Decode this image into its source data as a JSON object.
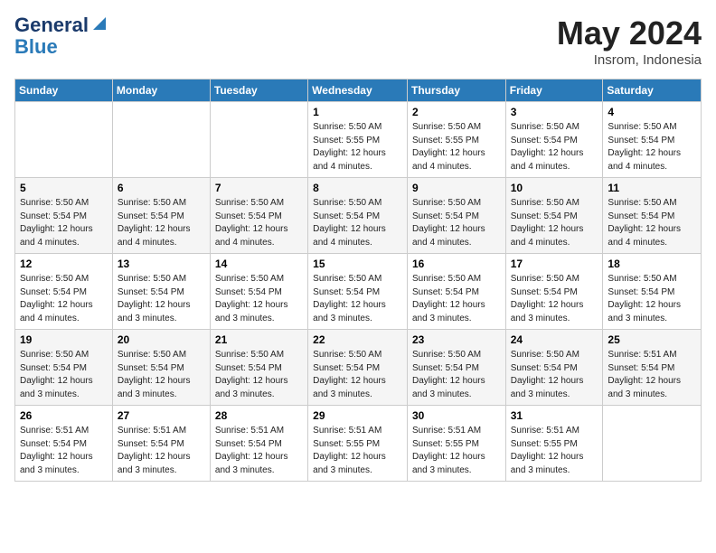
{
  "header": {
    "logo_line1": "General",
    "logo_line2": "Blue",
    "month_year": "May 2024",
    "location": "Insrom, Indonesia"
  },
  "weekdays": [
    "Sunday",
    "Monday",
    "Tuesday",
    "Wednesday",
    "Thursday",
    "Friday",
    "Saturday"
  ],
  "weeks": [
    [
      {
        "day": "",
        "info": ""
      },
      {
        "day": "",
        "info": ""
      },
      {
        "day": "",
        "info": ""
      },
      {
        "day": "1",
        "info": "Sunrise: 5:50 AM\nSunset: 5:55 PM\nDaylight: 12 hours\nand 4 minutes."
      },
      {
        "day": "2",
        "info": "Sunrise: 5:50 AM\nSunset: 5:55 PM\nDaylight: 12 hours\nand 4 minutes."
      },
      {
        "day": "3",
        "info": "Sunrise: 5:50 AM\nSunset: 5:54 PM\nDaylight: 12 hours\nand 4 minutes."
      },
      {
        "day": "4",
        "info": "Sunrise: 5:50 AM\nSunset: 5:54 PM\nDaylight: 12 hours\nand 4 minutes."
      }
    ],
    [
      {
        "day": "5",
        "info": "Sunrise: 5:50 AM\nSunset: 5:54 PM\nDaylight: 12 hours\nand 4 minutes."
      },
      {
        "day": "6",
        "info": "Sunrise: 5:50 AM\nSunset: 5:54 PM\nDaylight: 12 hours\nand 4 minutes."
      },
      {
        "day": "7",
        "info": "Sunrise: 5:50 AM\nSunset: 5:54 PM\nDaylight: 12 hours\nand 4 minutes."
      },
      {
        "day": "8",
        "info": "Sunrise: 5:50 AM\nSunset: 5:54 PM\nDaylight: 12 hours\nand 4 minutes."
      },
      {
        "day": "9",
        "info": "Sunrise: 5:50 AM\nSunset: 5:54 PM\nDaylight: 12 hours\nand 4 minutes."
      },
      {
        "day": "10",
        "info": "Sunrise: 5:50 AM\nSunset: 5:54 PM\nDaylight: 12 hours\nand 4 minutes."
      },
      {
        "day": "11",
        "info": "Sunrise: 5:50 AM\nSunset: 5:54 PM\nDaylight: 12 hours\nand 4 minutes."
      }
    ],
    [
      {
        "day": "12",
        "info": "Sunrise: 5:50 AM\nSunset: 5:54 PM\nDaylight: 12 hours\nand 4 minutes."
      },
      {
        "day": "13",
        "info": "Sunrise: 5:50 AM\nSunset: 5:54 PM\nDaylight: 12 hours\nand 3 minutes."
      },
      {
        "day": "14",
        "info": "Sunrise: 5:50 AM\nSunset: 5:54 PM\nDaylight: 12 hours\nand 3 minutes."
      },
      {
        "day": "15",
        "info": "Sunrise: 5:50 AM\nSunset: 5:54 PM\nDaylight: 12 hours\nand 3 minutes."
      },
      {
        "day": "16",
        "info": "Sunrise: 5:50 AM\nSunset: 5:54 PM\nDaylight: 12 hours\nand 3 minutes."
      },
      {
        "day": "17",
        "info": "Sunrise: 5:50 AM\nSunset: 5:54 PM\nDaylight: 12 hours\nand 3 minutes."
      },
      {
        "day": "18",
        "info": "Sunrise: 5:50 AM\nSunset: 5:54 PM\nDaylight: 12 hours\nand 3 minutes."
      }
    ],
    [
      {
        "day": "19",
        "info": "Sunrise: 5:50 AM\nSunset: 5:54 PM\nDaylight: 12 hours\nand 3 minutes."
      },
      {
        "day": "20",
        "info": "Sunrise: 5:50 AM\nSunset: 5:54 PM\nDaylight: 12 hours\nand 3 minutes."
      },
      {
        "day": "21",
        "info": "Sunrise: 5:50 AM\nSunset: 5:54 PM\nDaylight: 12 hours\nand 3 minutes."
      },
      {
        "day": "22",
        "info": "Sunrise: 5:50 AM\nSunset: 5:54 PM\nDaylight: 12 hours\nand 3 minutes."
      },
      {
        "day": "23",
        "info": "Sunrise: 5:50 AM\nSunset: 5:54 PM\nDaylight: 12 hours\nand 3 minutes."
      },
      {
        "day": "24",
        "info": "Sunrise: 5:50 AM\nSunset: 5:54 PM\nDaylight: 12 hours\nand 3 minutes."
      },
      {
        "day": "25",
        "info": "Sunrise: 5:51 AM\nSunset: 5:54 PM\nDaylight: 12 hours\nand 3 minutes."
      }
    ],
    [
      {
        "day": "26",
        "info": "Sunrise: 5:51 AM\nSunset: 5:54 PM\nDaylight: 12 hours\nand 3 minutes."
      },
      {
        "day": "27",
        "info": "Sunrise: 5:51 AM\nSunset: 5:54 PM\nDaylight: 12 hours\nand 3 minutes."
      },
      {
        "day": "28",
        "info": "Sunrise: 5:51 AM\nSunset: 5:54 PM\nDaylight: 12 hours\nand 3 minutes."
      },
      {
        "day": "29",
        "info": "Sunrise: 5:51 AM\nSunset: 5:55 PM\nDaylight: 12 hours\nand 3 minutes."
      },
      {
        "day": "30",
        "info": "Sunrise: 5:51 AM\nSunset: 5:55 PM\nDaylight: 12 hours\nand 3 minutes."
      },
      {
        "day": "31",
        "info": "Sunrise: 5:51 AM\nSunset: 5:55 PM\nDaylight: 12 hours\nand 3 minutes."
      },
      {
        "day": "",
        "info": ""
      }
    ]
  ]
}
